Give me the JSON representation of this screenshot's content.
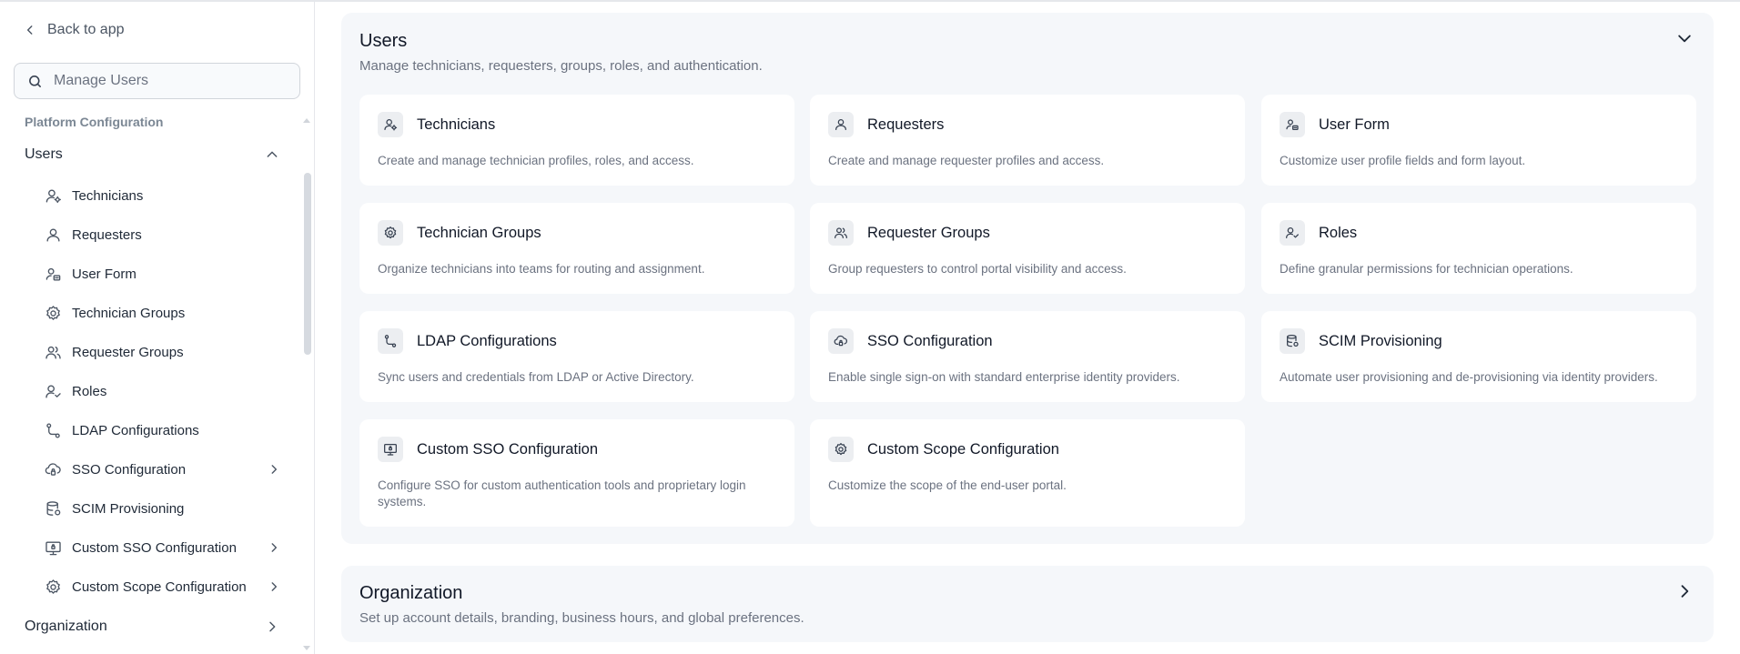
{
  "sidebar": {
    "back_label": "Back to app",
    "search_placeholder": "Manage Users",
    "section_label": "Platform Configuration",
    "users_group_label": "Users",
    "items": [
      {
        "label": "Technicians",
        "icon": "user-gear-icon"
      },
      {
        "label": "Requesters",
        "icon": "user-icon"
      },
      {
        "label": "User Form",
        "icon": "user-form-icon"
      },
      {
        "label": "Technician Groups",
        "icon": "gear-icon"
      },
      {
        "label": "Requester Groups",
        "icon": "users-icon"
      },
      {
        "label": "Roles",
        "icon": "user-check-icon"
      },
      {
        "label": "LDAP Configurations",
        "icon": "route-icon"
      },
      {
        "label": "SSO Configuration",
        "icon": "cloud-lock-icon",
        "has_submenu": true
      },
      {
        "label": "SCIM Provisioning",
        "icon": "database-icon"
      },
      {
        "label": "Custom SSO Configuration",
        "icon": "monitor-lock-icon",
        "has_submenu": true
      },
      {
        "label": "Custom Scope Configuration",
        "icon": "gear-icon",
        "has_submenu": true
      }
    ],
    "organization_label": "Organization"
  },
  "main": {
    "users_section": {
      "title": "Users",
      "subtitle": "Manage technicians, requesters, groups, roles, and authentication.",
      "expanded": true,
      "cards": [
        {
          "title": "Technicians",
          "description": "Create and manage technician profiles, roles, and access.",
          "icon": "user-gear-icon"
        },
        {
          "title": "Requesters",
          "description": "Create and manage requester profiles and access.",
          "icon": "user-icon"
        },
        {
          "title": "User Form",
          "description": "Customize user profile fields and form layout.",
          "icon": "user-form-icon"
        },
        {
          "title": "Technician Groups",
          "description": "Organize technicians into teams for routing and assignment.",
          "icon": "gear-icon"
        },
        {
          "title": "Requester Groups",
          "description": "Group requesters to control portal visibility and access.",
          "icon": "users-icon"
        },
        {
          "title": "Roles",
          "description": "Define granular permissions for technician operations.",
          "icon": "user-check-icon"
        },
        {
          "title": "LDAP Configurations",
          "description": "Sync users and credentials from LDAP or Active Directory.",
          "icon": "route-icon"
        },
        {
          "title": "SSO Configuration",
          "description": "Enable single sign-on with standard enterprise identity providers.",
          "icon": "cloud-lock-icon"
        },
        {
          "title": "SCIM Provisioning",
          "description": "Automate user provisioning and de-provisioning via identity providers.",
          "icon": "database-icon"
        },
        {
          "title": "Custom SSO Configuration",
          "description": "Configure SSO for custom authentication tools and proprietary login systems.",
          "icon": "monitor-lock-icon"
        },
        {
          "title": "Custom Scope Configuration",
          "description": "Customize the scope of the end-user portal.",
          "icon": "gear-icon"
        }
      ]
    },
    "organization_section": {
      "title": "Organization",
      "subtitle": "Set up account details, branding, business hours, and global preferences.",
      "expanded": false
    }
  },
  "colors": {
    "panel_bg": "#f5f7fa",
    "text_primary": "#111827",
    "text_muted": "#6b7280",
    "icon_bg": "#eceef1"
  }
}
